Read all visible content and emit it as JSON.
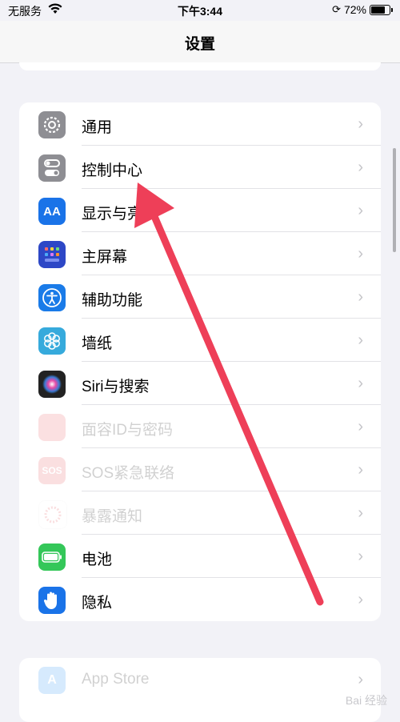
{
  "status_bar": {
    "carrier": "无服务",
    "time": "下午3:44",
    "battery": "72%"
  },
  "nav": {
    "title": "设置"
  },
  "groups": [
    [
      {
        "label": "通用",
        "icon": "gear-icon",
        "color": "#8e8e93"
      },
      {
        "label": "控制中心",
        "icon": "toggle-icon",
        "color": "#8e8e93"
      },
      {
        "label": "显示与亮度",
        "icon": "text-size-icon",
        "color": "#1a73e8"
      },
      {
        "label": "主屏幕",
        "icon": "app-grid-icon",
        "color": "#2d47c6"
      },
      {
        "label": "辅助功能",
        "icon": "accessibility-icon",
        "color": "#1a7be8"
      },
      {
        "label": "墙纸",
        "icon": "flower-icon",
        "color": "#36aadc"
      },
      {
        "label": "Siri与搜索",
        "icon": "siri-icon",
        "color": "#222"
      },
      {
        "label": "面容ID与密码",
        "icon": "faceid-icon",
        "color": "#e8525a"
      },
      {
        "label": "SOS紧急联络",
        "icon": "sos-icon",
        "color": "#e8525a"
      },
      {
        "label": "暴露通知",
        "icon": "exposure-icon",
        "color": "#ffffff"
      },
      {
        "label": "电池",
        "icon": "battery-icon",
        "color": "#34c759"
      },
      {
        "label": "隐私",
        "icon": "hand-icon",
        "color": "#1a73e8"
      }
    ],
    [
      {
        "label": "App Store",
        "icon": "app-store-icon",
        "color": "#1c8cf5"
      }
    ]
  ],
  "watermark": "Bai 经验"
}
